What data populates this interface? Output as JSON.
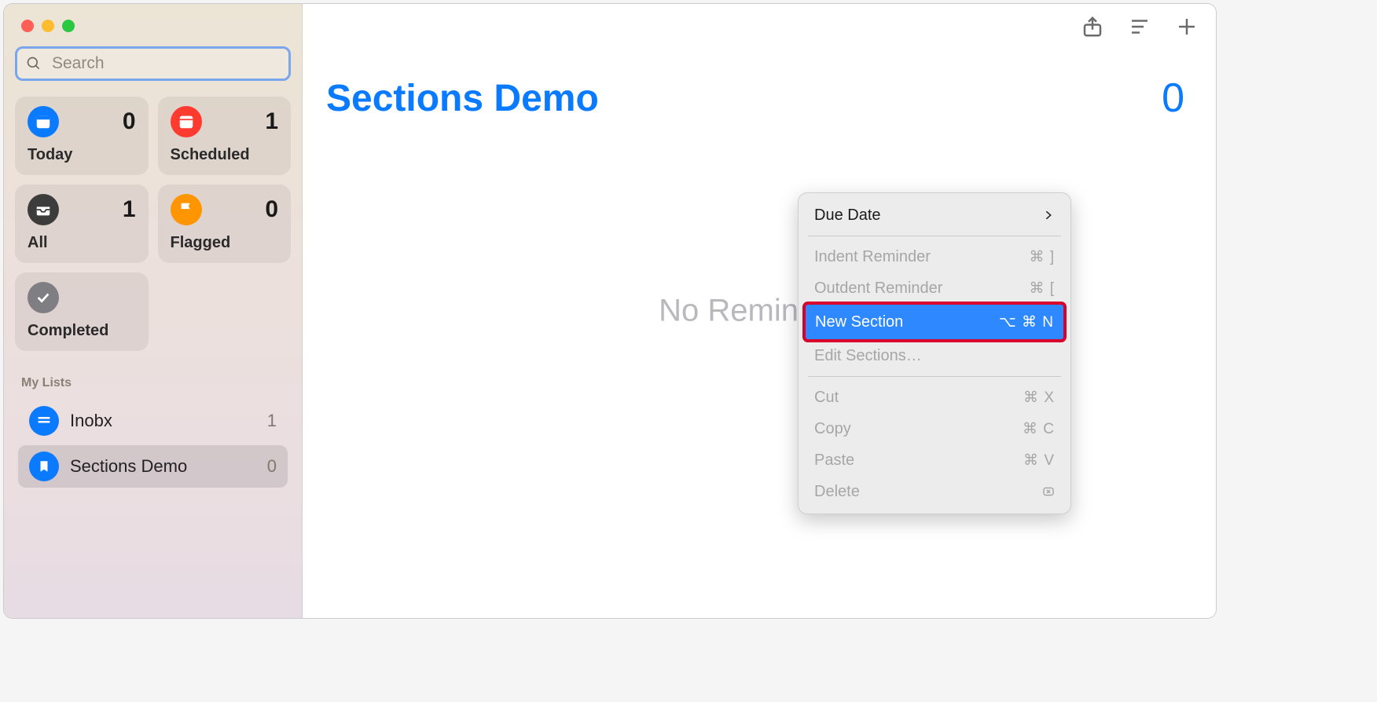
{
  "sidebar": {
    "search_placeholder": "Search",
    "smart": {
      "today": {
        "label": "Today",
        "count": "0"
      },
      "scheduled": {
        "label": "Scheduled",
        "count": "1"
      },
      "all": {
        "label": "All",
        "count": "1"
      },
      "flagged": {
        "label": "Flagged",
        "count": "0"
      },
      "completed": {
        "label": "Completed",
        "count": ""
      }
    },
    "lists_header": "My Lists",
    "lists": [
      {
        "name": "Inobx",
        "count": "1"
      },
      {
        "name": "Sections Demo",
        "count": "0"
      }
    ]
  },
  "main": {
    "title": "Sections Demo",
    "count": "0",
    "empty_text": "No Reminders"
  },
  "context_menu": {
    "due_date": "Due Date",
    "indent": {
      "label": "Indent Reminder",
      "shortcut": "⌘ ]"
    },
    "outdent": {
      "label": "Outdent Reminder",
      "shortcut": "⌘ ["
    },
    "new_section": {
      "label": "New Section",
      "shortcut": "⌥ ⌘ N"
    },
    "edit_sections": "Edit Sections…",
    "cut": {
      "label": "Cut",
      "shortcut": "⌘ X"
    },
    "copy": {
      "label": "Copy",
      "shortcut": "⌘ C"
    },
    "paste": {
      "label": "Paste",
      "shortcut": "⌘ V"
    },
    "delete": "Delete"
  }
}
